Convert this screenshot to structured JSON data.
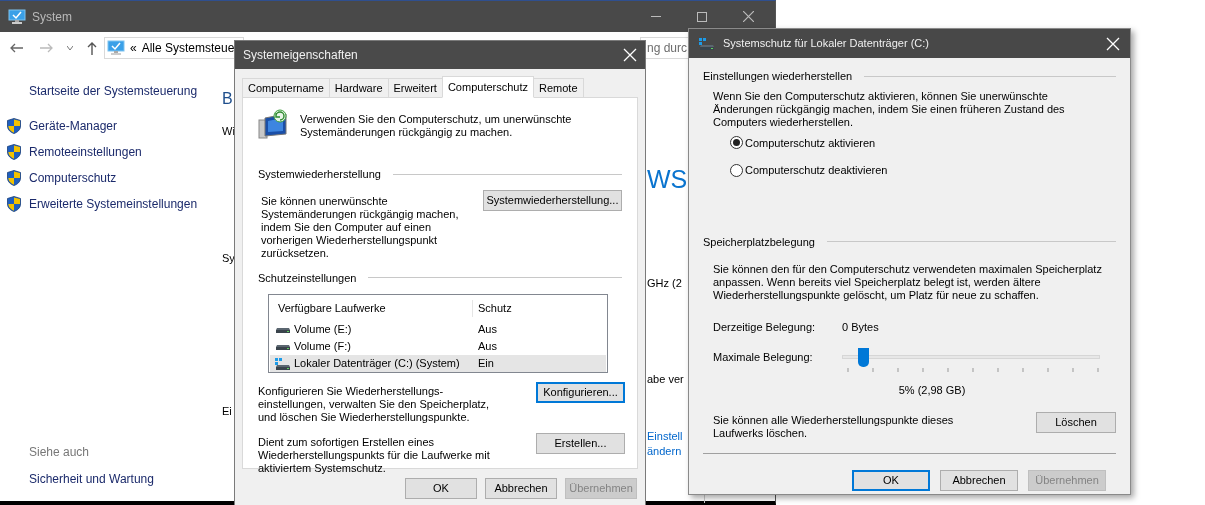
{
  "system_window": {
    "title": "System",
    "address": {
      "prefix": "«",
      "text": "Alle Systemsteue"
    },
    "search": {
      "value": "ng durc"
    },
    "sidebar": {
      "home": "Startseite der Systemsteuerung",
      "items": [
        "Geräte-Manager",
        "Remoteeinstellungen",
        "Computerschutz",
        "Erweiterte Systemeinstellungen"
      ],
      "see_also": {
        "heading": "Siehe auch",
        "items": [
          "Sicherheit und Wartung"
        ]
      }
    },
    "left_fragments": [
      {
        "kind": "heading",
        "text": "B"
      },
      {
        "kind": "text",
        "text": "Wi"
      },
      {
        "kind": "text",
        "text": "Sy"
      },
      {
        "kind": "text",
        "text": "Ei"
      }
    ],
    "right_fragments": [
      {
        "kind": "logo",
        "text": "WS"
      },
      {
        "kind": "text",
        "text": "GHz  (2"
      },
      {
        "kind": "text",
        "text": "abe ver"
      },
      {
        "kind": "link",
        "text": "Einstell"
      },
      {
        "kind": "link",
        "text": "ändern"
      }
    ]
  },
  "properties_dialog": {
    "title": "Systemeigenschaften",
    "tabs": [
      {
        "label": "Computername",
        "selected": false
      },
      {
        "label": "Hardware",
        "selected": false
      },
      {
        "label": "Erweitert",
        "selected": false
      },
      {
        "label": "Computerschutz",
        "selected": true
      },
      {
        "label": "Remote",
        "selected": false
      }
    ],
    "intro": "Verwenden Sie den Computerschutz, um unerwünschte Systemänderungen rückgängig zu machen.",
    "restore_group": {
      "heading": "Systemwiederherstellung",
      "text": "Sie können unerwünschte Systemänderungen rückgängig machen, indem Sie den Computer auf einen vorherigen Wiederherstellungspunkt zurücksetzen.",
      "button": "Systemwiederherstellung..."
    },
    "protection_group": {
      "heading": "Schutzeinstellungen",
      "columns": [
        "Verfügbare Laufwerke",
        "Schutz"
      ],
      "rows": [
        {
          "kind": "drive",
          "name": "Volume (E:)",
          "protection": "Aus",
          "selected": false
        },
        {
          "kind": "drive",
          "name": "Volume (F:)",
          "protection": "Aus",
          "selected": false
        },
        {
          "kind": "system_drive",
          "name": "Lokaler Datenträger (C:) (System)",
          "protection": "Ein",
          "selected": true
        }
      ]
    },
    "actions": [
      {
        "text": "Konfigurieren Sie Wiederherstellungs-einstellungen, verwalten Sie den Speicherplatz, und löschen Sie Wiederherstellungspunkte.",
        "button": "Konfigurieren...",
        "focused": true
      },
      {
        "text": "Dient zum sofortigen Erstellen eines Wiederherstellungspunkts für die Laufwerke mit aktiviertem Systemschutz.",
        "button": "Erstellen...",
        "focused": false
      }
    ],
    "buttons": [
      {
        "label": "OK",
        "disabled": false
      },
      {
        "label": "Abbrechen",
        "disabled": false
      },
      {
        "label": "Übernehmen",
        "disabled": true
      }
    ]
  },
  "protection_dialog": {
    "title": "Systemschutz für Lokaler Datenträger (C:)",
    "restore_section": {
      "heading": "Einstellungen wiederherstellen",
      "text": "Wenn Sie den Computerschutz aktivieren, können Sie unerwünschte Änderungen rückgängig machen, indem Sie einen früheren Zustand des Computers wiederherstellen.",
      "options": [
        {
          "label": "Computerschutz aktivieren",
          "selected": true
        },
        {
          "label": "Computerschutz deaktivieren",
          "selected": false
        }
      ]
    },
    "usage_section": {
      "heading": "Speicherplatzbelegung",
      "text": "Sie können den für den Computerschutz verwendeten maximalen Speicherplatz anpassen. Wenn bereits viel Speicherplatz belegt ist, werden ältere Wiederherstellungspunkte gelöscht, um Platz für neue zu schaffen.",
      "current_label": "Derzeitige Belegung:",
      "current_value": "0 Bytes",
      "max_label": "Maximale Belegung:",
      "max": {
        "level": 0.05
      },
      "max_reading": "5% (2,98 GB)",
      "delete_text": "Sie können alle Wiederherstellungspunkte dieses Laufwerks löschen.",
      "delete_button": "Löschen"
    },
    "buttons": [
      {
        "label": "OK",
        "default": true,
        "disabled": false
      },
      {
        "label": "Abbrechen",
        "default": false,
        "disabled": false
      },
      {
        "label": "Übernehmen",
        "default": false,
        "disabled": true
      }
    ]
  }
}
